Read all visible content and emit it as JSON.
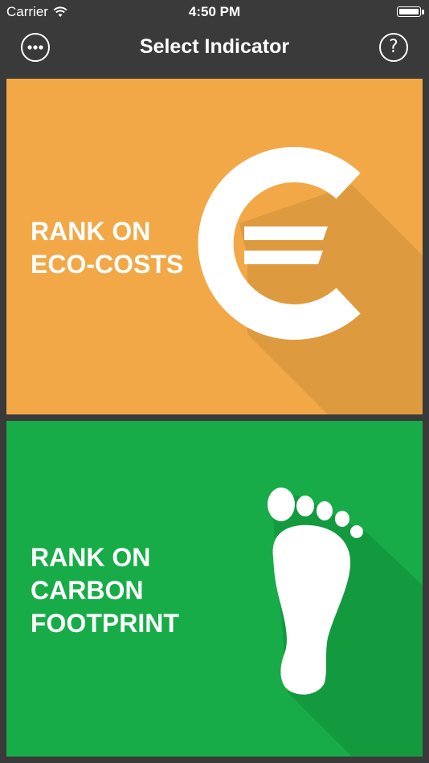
{
  "status_bar": {
    "carrier": "Carrier",
    "time": "4:50 PM"
  },
  "nav": {
    "title": "Select Indicator",
    "left_icon": "more-options-icon",
    "right_icon": "help-icon",
    "help_glyph": "?"
  },
  "cards": [
    {
      "id": "eco-costs",
      "lines": [
        "RANK ON",
        "ECO-COSTS"
      ],
      "icon": "euro-icon",
      "color": "#f2a847",
      "shadow_color": "#de9a3f"
    },
    {
      "id": "carbon-footprint",
      "lines": [
        "RANK ON",
        "CARBON",
        "FOOTPRINT"
      ],
      "icon": "footprint-icon",
      "color": "#17ac47",
      "shadow_color": "#139a3e"
    }
  ],
  "colors": {
    "background": "#3a3a3a",
    "text": "#ffffff"
  }
}
